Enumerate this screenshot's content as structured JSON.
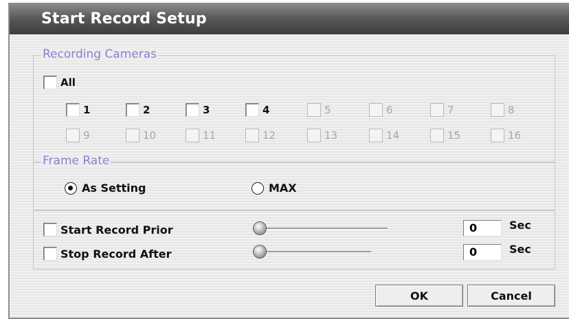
{
  "dialog": {
    "title": "Start Record Setup"
  },
  "recording_cameras": {
    "legend": "Recording Cameras",
    "all_label": "All",
    "cameras_row1": [
      {
        "label": "1",
        "enabled": true
      },
      {
        "label": "2",
        "enabled": true
      },
      {
        "label": "3",
        "enabled": true
      },
      {
        "label": "4",
        "enabled": true
      },
      {
        "label": "5",
        "enabled": false
      },
      {
        "label": "6",
        "enabled": false
      },
      {
        "label": "7",
        "enabled": false
      },
      {
        "label": "8",
        "enabled": false
      }
    ],
    "cameras_row2": [
      {
        "label": "9",
        "enabled": false
      },
      {
        "label": "10",
        "enabled": false
      },
      {
        "label": "11",
        "enabled": false
      },
      {
        "label": "12",
        "enabled": false
      },
      {
        "label": "13",
        "enabled": false
      },
      {
        "label": "14",
        "enabled": false
      },
      {
        "label": "15",
        "enabled": false
      },
      {
        "label": "16",
        "enabled": false
      }
    ]
  },
  "frame_rate": {
    "legend": "Frame Rate",
    "options": [
      "As Setting",
      "MAX"
    ],
    "selected": "As Setting"
  },
  "prior": {
    "label": "Start Record Prior",
    "value": "0",
    "unit": "Sec"
  },
  "after": {
    "label": "Stop Record After",
    "value": "0",
    "unit": "Sec"
  },
  "buttons": {
    "ok": "OK",
    "cancel": "Cancel"
  }
}
